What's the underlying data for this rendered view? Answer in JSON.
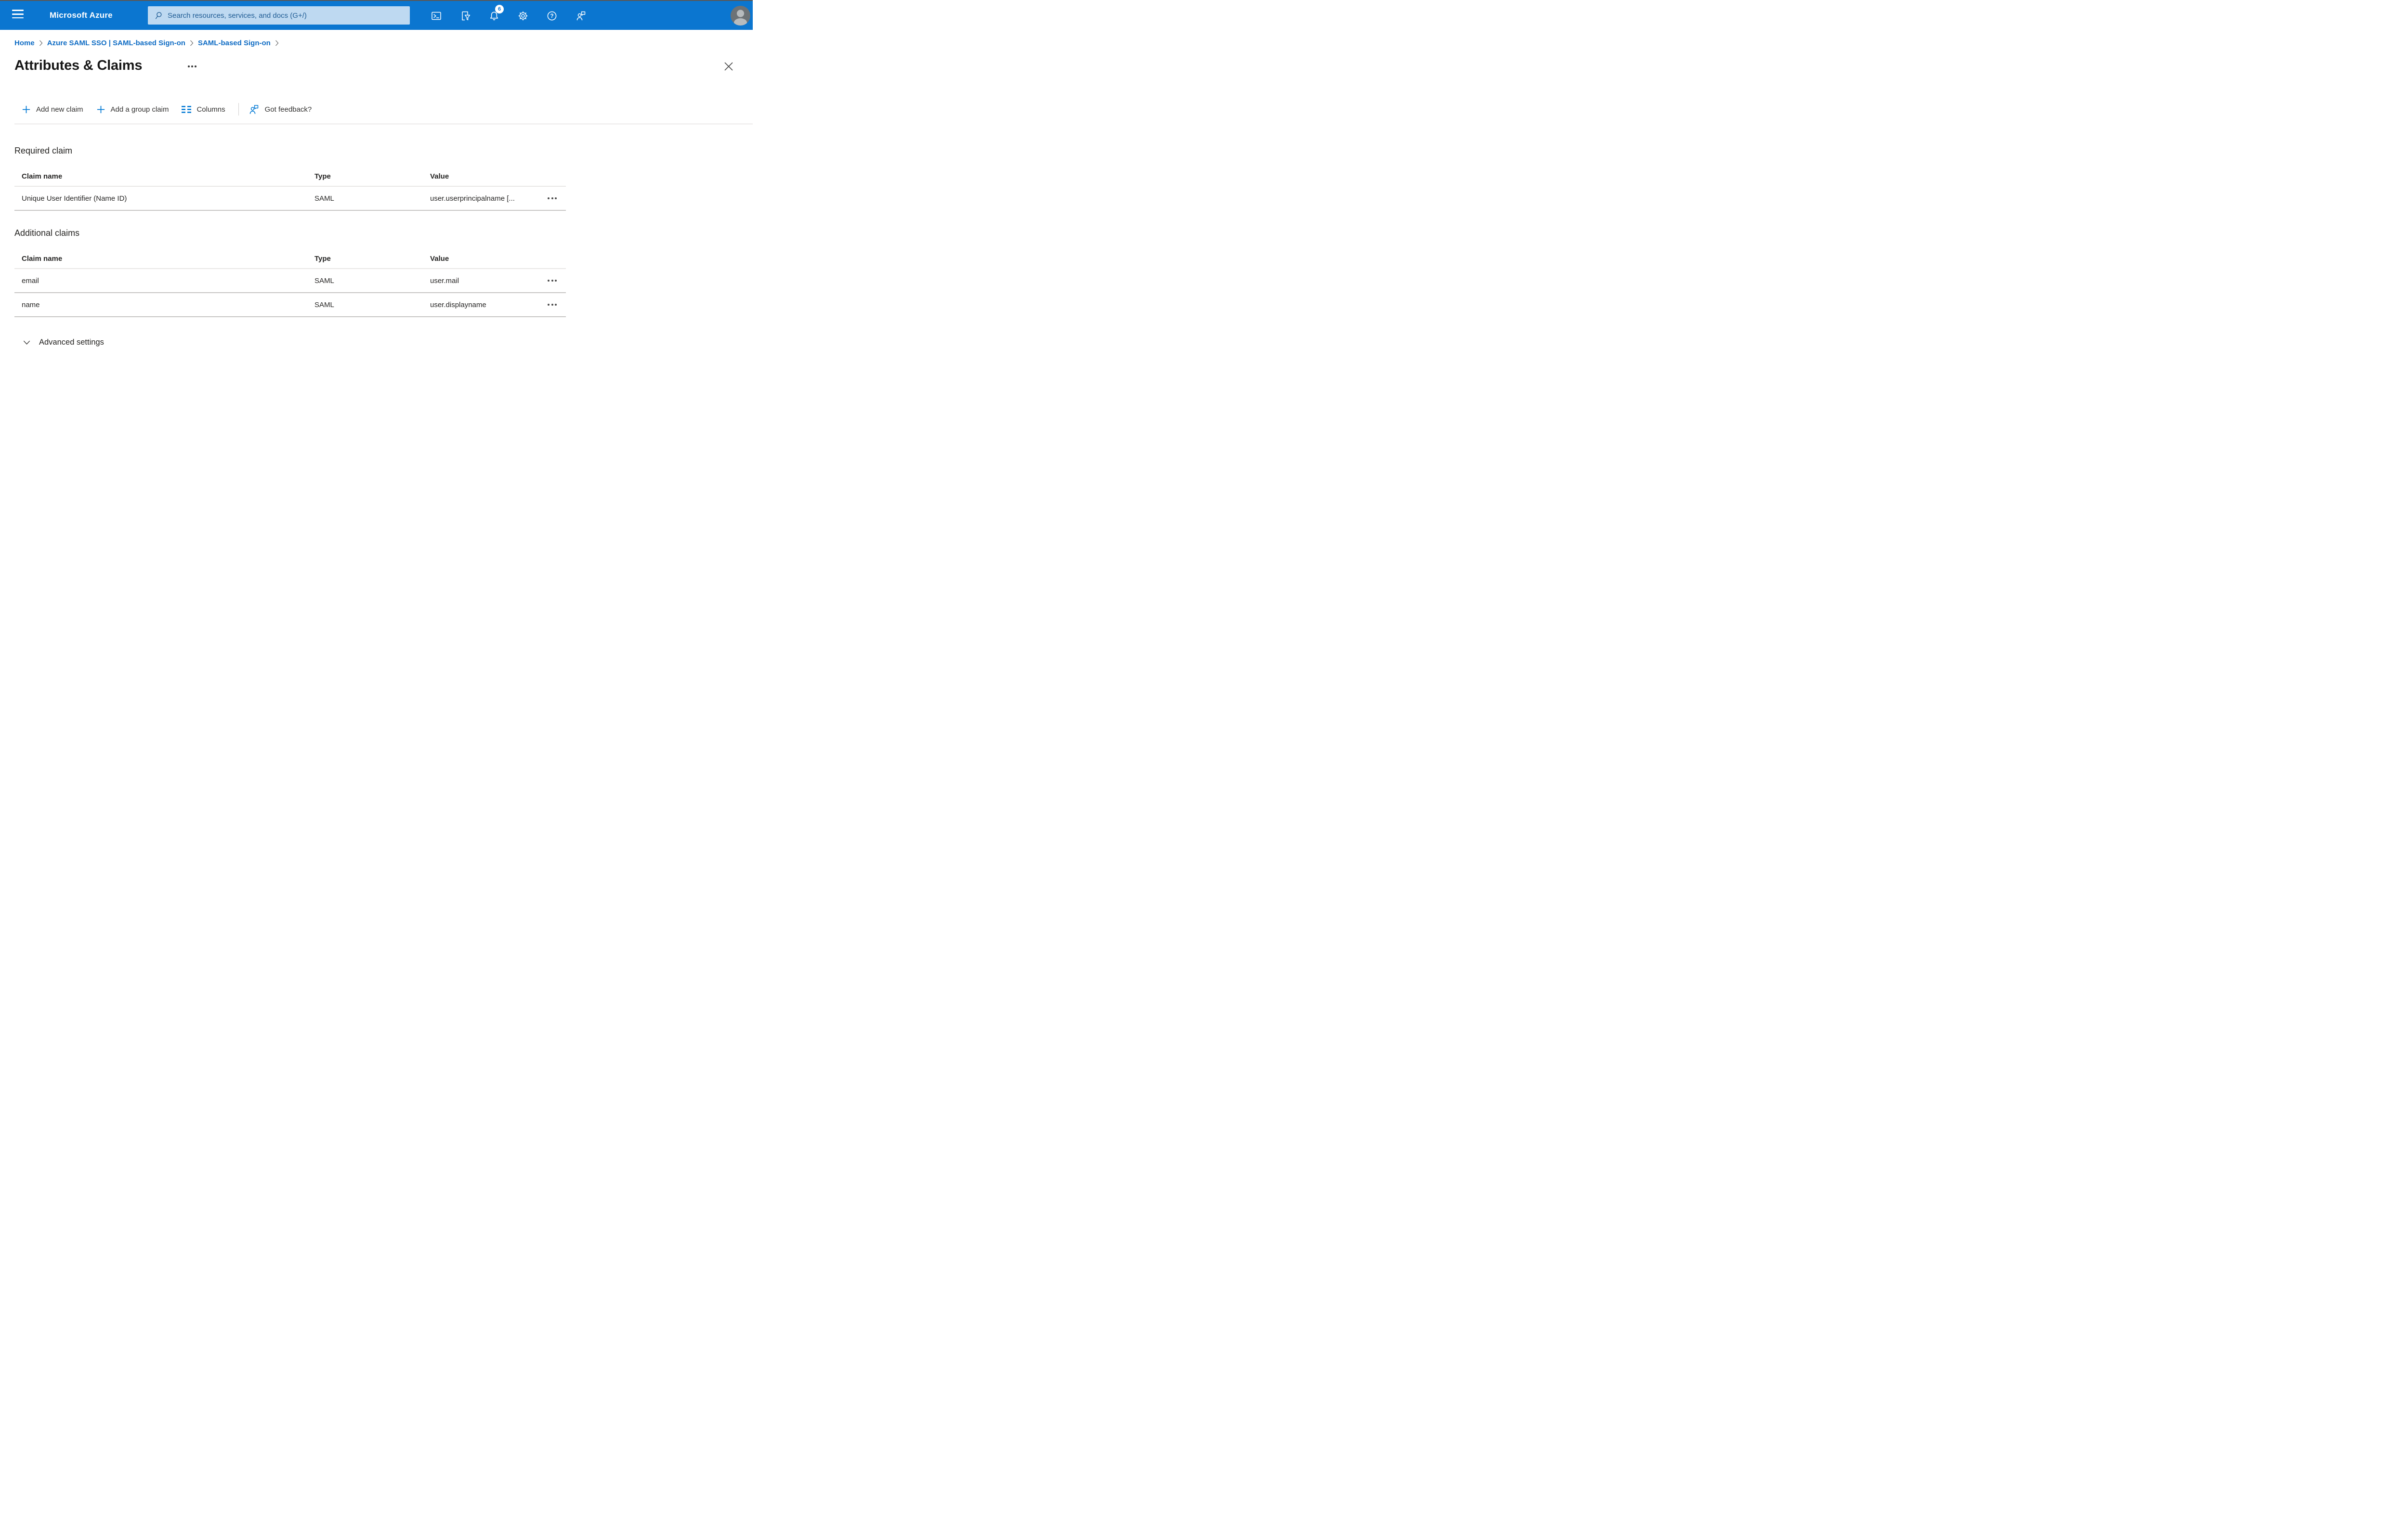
{
  "topbar": {
    "brand": "Microsoft Azure",
    "search_placeholder": "Search resources, services, and docs (G+/)",
    "notification_count": "6"
  },
  "breadcrumb": {
    "items": [
      "Home",
      "Azure SAML SSO | SAML-based Sign-on",
      "SAML-based Sign-on"
    ]
  },
  "page": {
    "title": "Attributes & Claims"
  },
  "toolbar": {
    "add_new_claim": "Add new claim",
    "add_group_claim": "Add a group claim",
    "columns": "Columns",
    "got_feedback": "Got feedback?"
  },
  "required_section": {
    "title": "Required claim",
    "headers": {
      "claim_name": "Claim name",
      "type": "Type",
      "value": "Value"
    },
    "rows": [
      {
        "claim_name": "Unique User Identifier (Name ID)",
        "type": "SAML",
        "value": "user.userprincipalname [..."
      }
    ]
  },
  "additional_section": {
    "title": "Additional claims",
    "headers": {
      "claim_name": "Claim name",
      "type": "Type",
      "value": "Value"
    },
    "rows": [
      {
        "claim_name": "email",
        "type": "SAML",
        "value": "user.mail"
      },
      {
        "claim_name": "name",
        "type": "SAML",
        "value": "user.displayname"
      }
    ]
  },
  "advanced": {
    "label": "Advanced settings"
  },
  "colors": {
    "topbar_blue": "#0b76d0",
    "accent_blue": "#0078d4",
    "search_bg": "#bed9f1",
    "link_blue": "#0f6cc4",
    "row_border": "#c8c7c5"
  }
}
